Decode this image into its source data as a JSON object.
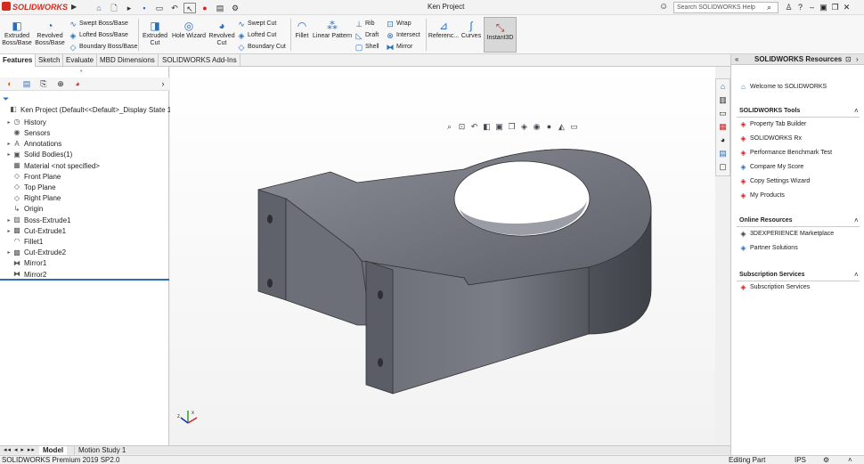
{
  "app": {
    "logo_text": "SOLIDWORKS",
    "title": "Ken Project",
    "brand_color": "#d52b1e"
  },
  "search": {
    "placeholder": "Search SOLIDWORKS Help"
  },
  "ribbon": {
    "extruded_boss": "Extruded Boss/Base",
    "revolved_boss": "Revolved Boss/Base",
    "swept_boss": "Swept Boss/Base",
    "lofted_boss": "Lofted Boss/Base",
    "boundary_boss": "Boundary Boss/Base",
    "extruded_cut": "Extruded Cut",
    "hole_wizard": "Hole Wizard",
    "revolved_cut": "Revolved Cut",
    "swept_cut": "Swept Cut",
    "lofted_cut": "Lofted Cut",
    "boundary_cut": "Boundary Cut",
    "fillet": "Fillet",
    "linear_pattern": "Linear Pattern",
    "rib": "Rib",
    "draft": "Draft",
    "shell": "Shell",
    "wrap": "Wrap",
    "intersect": "Intersect",
    "mirror": "Mirror",
    "reference": "Referenc...",
    "curves": "Curves",
    "instant3d": "Instant3D"
  },
  "tabs": [
    "Features",
    "Sketch",
    "Evaluate",
    "MBD Dimensions",
    "SOLIDWORKS Add-Ins"
  ],
  "tree": [
    {
      "label": "Ken Project  (Default<<Default>_Display State 1>)",
      "icon": "part-icon",
      "tw": ""
    },
    {
      "label": "History",
      "icon": "history-icon",
      "tw": "▸"
    },
    {
      "label": "Sensors",
      "icon": "sensor-icon",
      "tw": ""
    },
    {
      "label": "Annotations",
      "icon": "annotation-icon",
      "tw": "▸"
    },
    {
      "label": "Solid Bodies(1)",
      "icon": "solid-bodies-icon",
      "tw": "▸"
    },
    {
      "label": "Material <not specified>",
      "icon": "material-icon",
      "tw": ""
    },
    {
      "label": "Front Plane",
      "icon": "plane-icon",
      "tw": ""
    },
    {
      "label": "Top Plane",
      "icon": "plane-icon",
      "tw": ""
    },
    {
      "label": "Right Plane",
      "icon": "plane-icon",
      "tw": ""
    },
    {
      "label": "Origin",
      "icon": "origin-icon",
      "tw": ""
    },
    {
      "label": "Boss-Extrude1",
      "icon": "extrude-icon",
      "tw": "▸"
    },
    {
      "label": "Cut-Extrude1",
      "icon": "cut-extrude-icon",
      "tw": "▸"
    },
    {
      "label": "Fillet1",
      "icon": "fillet-icon",
      "tw": ""
    },
    {
      "label": "Cut-Extrude2",
      "icon": "cut-extrude-icon",
      "tw": "▸"
    },
    {
      "label": "Mirror1",
      "icon": "mirror-icon",
      "tw": ""
    },
    {
      "label": "Mirror2",
      "icon": "mirror-icon",
      "tw": ""
    }
  ],
  "bottom_tabs": [
    "Model",
    "Motion Study 1"
  ],
  "status": {
    "version": "SOLIDWORKS Premium 2019 SP2.0",
    "mode": "Editing Part",
    "units": "IPS"
  },
  "task_pane": {
    "title": "SOLIDWORKS Resources",
    "welcome": "Welcome to SOLIDWORKS",
    "tools_title": "SOLIDWORKS Tools",
    "tools": [
      "Property Tab Builder",
      "SOLIDWORKS Rx",
      "Performance Benchmark Test",
      "Compare My Score",
      "Copy Settings Wizard",
      "My Products"
    ],
    "online_title": "Online Resources",
    "online": [
      "3DEXPERIENCE Marketplace",
      "Partner Solutions"
    ],
    "subs_title": "Subscription Services",
    "subs": [
      "Subscription Services"
    ]
  }
}
